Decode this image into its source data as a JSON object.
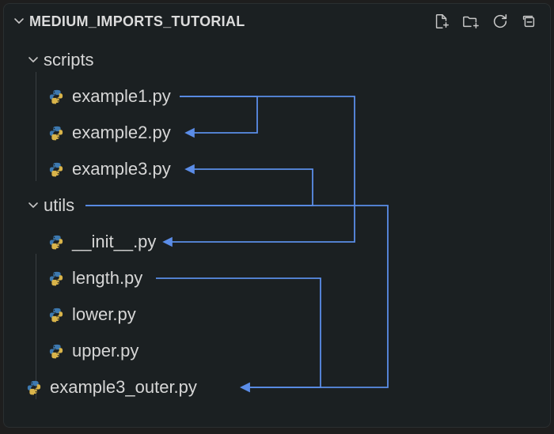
{
  "header": {
    "title": "MEDIUM_IMPORTS_TUTORIAL",
    "icons": {
      "new_file": "new-file-icon",
      "new_folder": "new-folder-icon",
      "refresh": "refresh-icon",
      "collapse": "collapse-all-icon"
    }
  },
  "tree": {
    "folders": [
      {
        "name": "scripts",
        "expanded": true,
        "children": [
          {
            "name": "example1.py"
          },
          {
            "name": "example2.py"
          },
          {
            "name": "example3.py"
          }
        ]
      },
      {
        "name": "utils",
        "expanded": true,
        "children": [
          {
            "name": "__init__.py"
          },
          {
            "name": "length.py"
          },
          {
            "name": "lower.py"
          },
          {
            "name": "upper.py"
          }
        ]
      }
    ],
    "root_files": [
      {
        "name": "example3_outer.py"
      }
    ]
  },
  "colors": {
    "connector": "#5b8de8",
    "arrow": "#5b8de8",
    "bg": "#1b2022",
    "text": "#d6d6d6"
  },
  "chart_data": {
    "type": "diagram",
    "edges": [
      {
        "from": "scripts/example1.py",
        "to": "scripts/example2.py"
      },
      {
        "from": "scripts/example1.py",
        "to": "utils/__init__.py"
      },
      {
        "from": "utils",
        "to": "scripts/example3.py"
      },
      {
        "from": "utils",
        "to": "example3_outer.py"
      },
      {
        "from": "utils/length.py",
        "to": "example3_outer.py"
      }
    ]
  }
}
